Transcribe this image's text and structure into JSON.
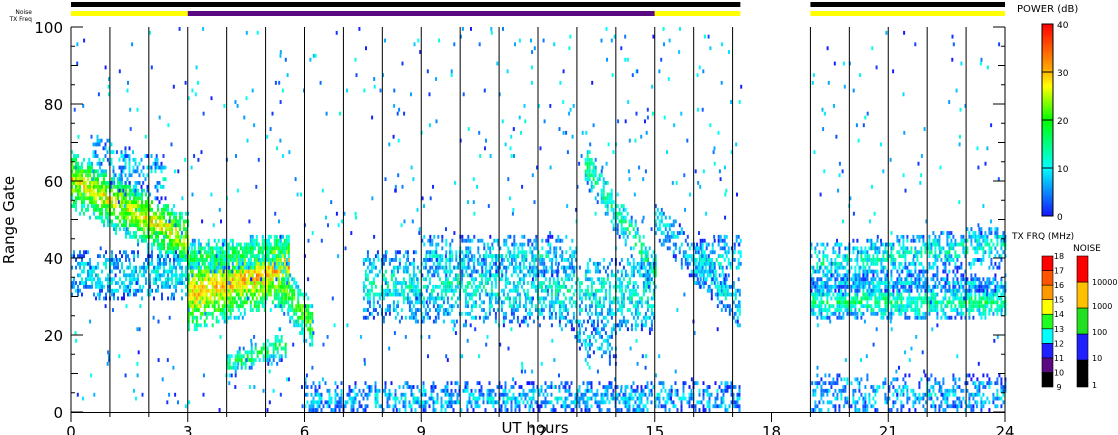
{
  "chart_data": {
    "type": "heatmap",
    "xlabel": "UT hours",
    "ylabel": "Range Gate",
    "xlim": [
      0,
      24
    ],
    "ylim": [
      0,
      100
    ],
    "x_ticks": [
      "0",
      "3",
      "6",
      "9",
      "12",
      "15",
      "18",
      "21",
      "24"
    ],
    "y_ticks": [
      "0",
      "20",
      "40",
      "60",
      "80",
      "100"
    ],
    "scan_lines_hours": [
      1,
      2,
      3,
      4,
      5,
      6,
      7,
      8,
      9,
      10,
      11,
      12,
      13,
      14,
      15,
      16,
      17,
      19,
      20,
      21,
      22,
      23
    ],
    "data_gaps_hours": [
      [
        17.2,
        19
      ]
    ],
    "status_bars": {
      "noise_label": "Noise",
      "txfreq_label": "TX Freq",
      "noise_segments": [
        {
          "start": 0,
          "end": 17.2,
          "color": "#000000"
        },
        {
          "start": 19,
          "end": 24,
          "color": "#000000"
        }
      ],
      "txfreq_segments": [
        {
          "start": 0,
          "end": 3,
          "color": "#ffff00"
        },
        {
          "start": 3,
          "end": 15,
          "color": "#5a0a80"
        },
        {
          "start": 15,
          "end": 17.2,
          "color": "#ffff00"
        },
        {
          "start": 19,
          "end": 24,
          "color": "#ffff00"
        }
      ]
    },
    "echo_regions": [
      {
        "t0": 0,
        "t1": 3,
        "g0": 60,
        "g1": 44,
        "half": 7,
        "power": 27,
        "density": 0.85
      },
      {
        "t0": 0,
        "t1": 3,
        "g0": 35,
        "g1": 35,
        "half": 6,
        "power": 10,
        "density": 0.6
      },
      {
        "t0": 0.5,
        "t1": 2.5,
        "g0": 66,
        "g1": 60,
        "half": 6,
        "power": 8,
        "density": 0.35
      },
      {
        "t0": 3,
        "t1": 5.6,
        "g0": 30,
        "g1": 37,
        "half": 9,
        "power": 30,
        "density": 0.9
      },
      {
        "t0": 3,
        "t1": 5.6,
        "g0": 40,
        "g1": 42,
        "half": 4,
        "power": 18,
        "density": 0.7
      },
      {
        "t0": 4,
        "t1": 5.5,
        "g0": 12,
        "g1": 17,
        "half": 3,
        "power": 18,
        "density": 0.7
      },
      {
        "t0": 5.4,
        "t1": 6.2,
        "g0": 32,
        "g1": 22,
        "half": 6,
        "power": 22,
        "density": 0.8
      },
      {
        "t0": 7.5,
        "t1": 15,
        "g0": 33,
        "g1": 30,
        "half": 9,
        "power": 12,
        "density": 0.55
      },
      {
        "t0": 9,
        "t1": 13,
        "g0": 40,
        "g1": 40,
        "half": 5,
        "power": 10,
        "density": 0.4
      },
      {
        "t0": 13,
        "t1": 14,
        "g0": 20,
        "g1": 16,
        "half": 4,
        "power": 8,
        "density": 0.5
      },
      {
        "t0": 13.2,
        "t1": 15,
        "g0": 64,
        "g1": 36,
        "half": 5,
        "power": 15,
        "density": 0.6
      },
      {
        "t0": 15,
        "t1": 17.2,
        "g0": 50,
        "g1": 26,
        "half": 5,
        "power": 10,
        "density": 0.6
      },
      {
        "t0": 16,
        "t1": 17.2,
        "g0": 38,
        "g1": 40,
        "half": 6,
        "power": 10,
        "density": 0.5
      },
      {
        "t0": 6,
        "t1": 17.2,
        "g0": 3,
        "g1": 3,
        "half": 4,
        "power": 8,
        "density": 0.55
      },
      {
        "t0": 19,
        "t1": 24,
        "g0": 28,
        "g1": 28,
        "half": 4,
        "power": 15,
        "density": 0.8
      },
      {
        "t0": 19,
        "t1": 24,
        "g0": 38,
        "g1": 43,
        "half": 5,
        "power": 12,
        "density": 0.6
      },
      {
        "t0": 19,
        "t1": 24,
        "g0": 33,
        "g1": 33,
        "half": 2,
        "power": 8,
        "density": 0.7
      },
      {
        "t0": 19,
        "t1": 24,
        "g0": 4,
        "g1": 4,
        "half": 5,
        "power": 8,
        "density": 0.45
      }
    ],
    "power_scale": {
      "title": "POWER (dB)",
      "ticks": [
        "0",
        "10",
        "20",
        "30",
        "40"
      ],
      "min": 0,
      "max": 40
    },
    "txfreq_scale": {
      "title": "TX FRQ (MHz)",
      "ticks": [
        "9",
        "10",
        "11",
        "12",
        "13",
        "14",
        "15",
        "16",
        "17",
        "18"
      ],
      "colors": [
        "#000000",
        "#5a0a80",
        "#2020ff",
        "#00ffff",
        "#20ff20",
        "#ffff00",
        "#ff9900",
        "#ff5500",
        "#ff0000"
      ]
    },
    "noise_scale": {
      "title": "NOISE",
      "ticks": [
        "1",
        "10",
        "100",
        "1000",
        "10000"
      ],
      "colors": [
        "#000000",
        "#2020ff",
        "#20e020",
        "#ffc000",
        "#ff0000"
      ]
    }
  }
}
